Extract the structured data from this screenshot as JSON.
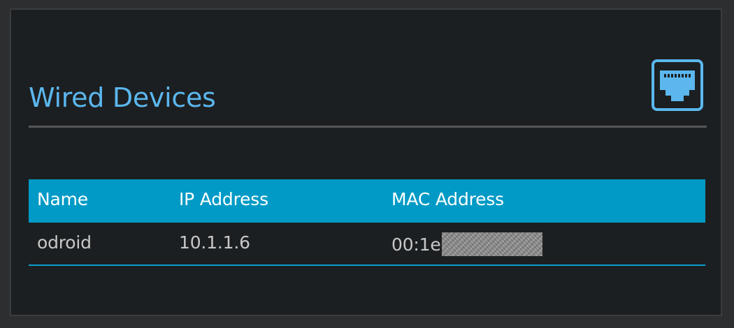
{
  "section": {
    "title": "Wired Devices",
    "icon": "ethernet-port-icon",
    "accent_color": "#5bb7ee"
  },
  "table": {
    "header_color": "#019ac6",
    "columns": [
      "Name",
      "IP Address",
      "MAC Address"
    ],
    "rows": [
      {
        "name": "odroid",
        "ip": "10.1.1.6",
        "mac_visible": "00:1e",
        "mac_redacted": true
      }
    ]
  }
}
